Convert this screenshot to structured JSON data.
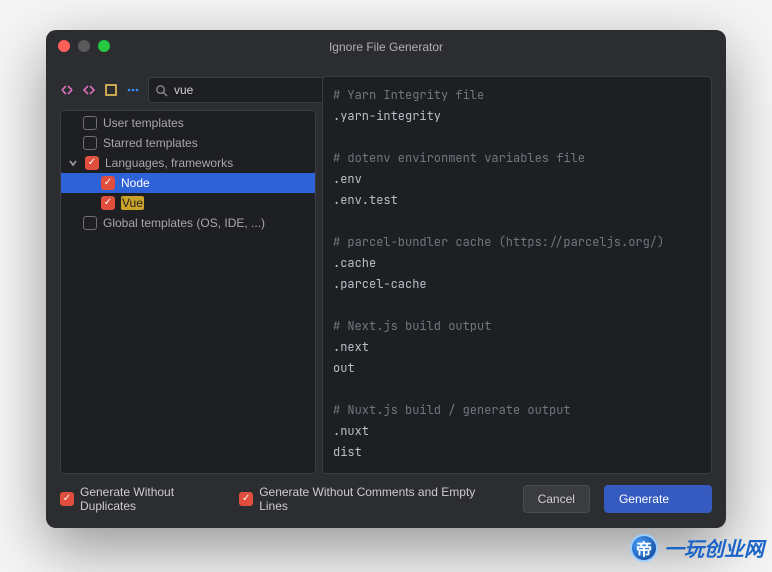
{
  "title": "Ignore File Generator",
  "search": {
    "value": "vue",
    "placeholder": ""
  },
  "tree": {
    "user_templates": "User templates",
    "starred_templates": "Starred templates",
    "languages_frameworks": "Languages, frameworks",
    "node": "Node",
    "vue": "Vue",
    "global_templates": "Global templates (OS, IDE, ...)"
  },
  "preview_lines": [
    {
      "t": "# Yarn Integrity file",
      "c": true
    },
    {
      "t": ".yarn-integrity",
      "c": false
    },
    {
      "t": "",
      "c": false
    },
    {
      "t": "# dotenv environment variables file",
      "c": true
    },
    {
      "t": ".env",
      "c": false
    },
    {
      "t": ".env.test",
      "c": false
    },
    {
      "t": "",
      "c": false
    },
    {
      "t": "# parcel-bundler cache (https://parceljs.org/)",
      "c": true
    },
    {
      "t": ".cache",
      "c": false
    },
    {
      "t": ".parcel-cache",
      "c": false
    },
    {
      "t": "",
      "c": false
    },
    {
      "t": "# Next.js build output",
      "c": true
    },
    {
      "t": ".next",
      "c": false
    },
    {
      "t": "out",
      "c": false
    },
    {
      "t": "",
      "c": false
    },
    {
      "t": "# Nuxt.js build / generate output",
      "c": true
    },
    {
      "t": ".nuxt",
      "c": false
    },
    {
      "t": "dist",
      "c": false
    }
  ],
  "footer": {
    "opt1": "Generate Without Duplicates",
    "opt2": "Generate Without Comments and Empty Lines",
    "cancel": "Cancel",
    "generate": "Generate"
  },
  "watermark": "一玩创业网"
}
